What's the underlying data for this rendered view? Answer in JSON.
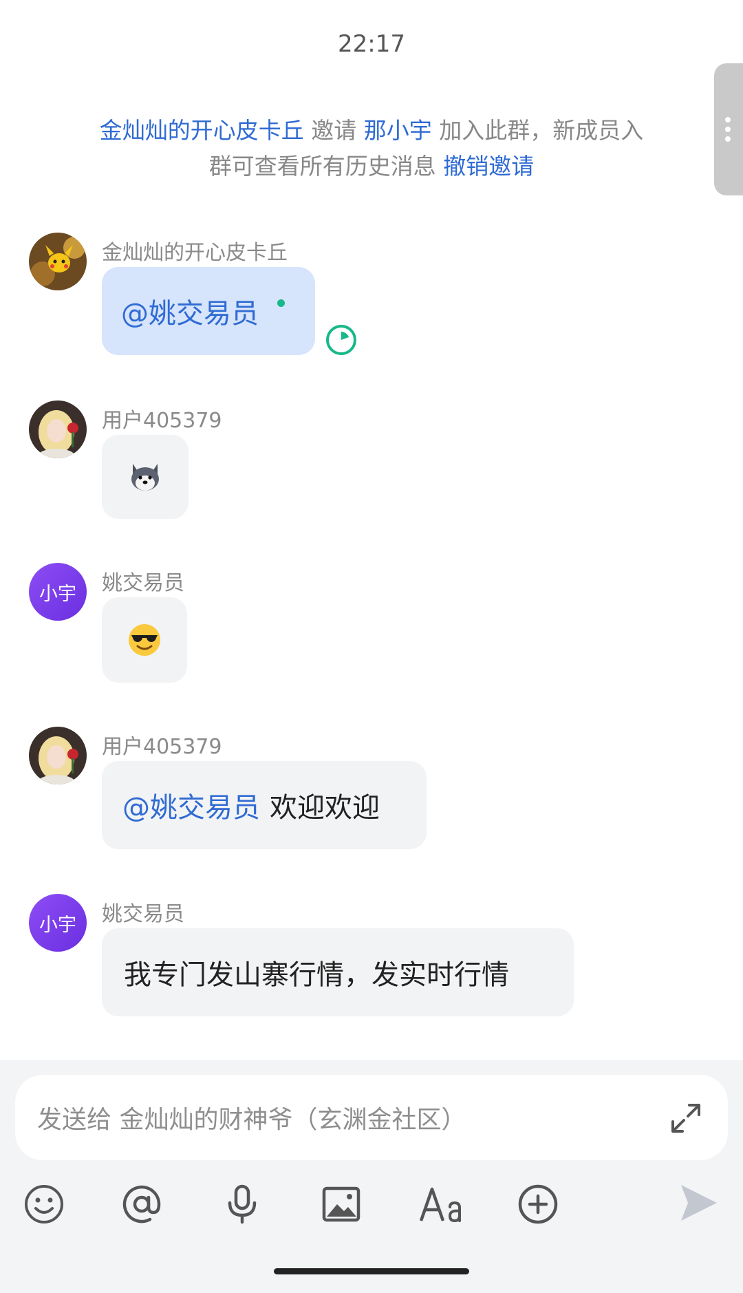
{
  "status": {
    "time": "22:17"
  },
  "system_note": {
    "inviter": "金灿灿的开心皮卡丘",
    "invite_word": "邀请",
    "invitee": "那小宇",
    "text_1": "加入此群，新成员入",
    "text_2": "群可查看所有历史消息",
    "revoke_label": "撤销邀请"
  },
  "messages": [
    {
      "sender": "金灿灿的开心皮卡丘",
      "mention": "@姚交易员",
      "text": "",
      "avatar": "pikachu-avatar"
    },
    {
      "sender": "用户405379",
      "sticker": "husky-dog-emoji",
      "avatar": "girl-rose-avatar"
    },
    {
      "sender": "姚交易员",
      "sticker": "sunglasses-emoji",
      "avatar_text": "小宇"
    },
    {
      "sender": "用户405379",
      "mention": "@姚交易员",
      "text": "欢迎欢迎",
      "avatar": "girl-rose-avatar"
    },
    {
      "sender": "姚交易员",
      "text": "我专门发山寨行情，发实时行情",
      "avatar_text": "小宇"
    }
  ],
  "input": {
    "placeholder": "发送给 金灿灿的财神爷（玄渊金社区）"
  },
  "toolbar": [
    "emoji-icon",
    "at-icon",
    "microphone-icon",
    "image-icon",
    "font-icon",
    "plus-icon",
    "send-icon"
  ],
  "colors": {
    "link": "#2f6bd3",
    "bubble": "#f2f3f5",
    "self_bubble": "#d6e4fc",
    "avatar_purple": "#7b3ff0",
    "status_green": "#17b889"
  }
}
